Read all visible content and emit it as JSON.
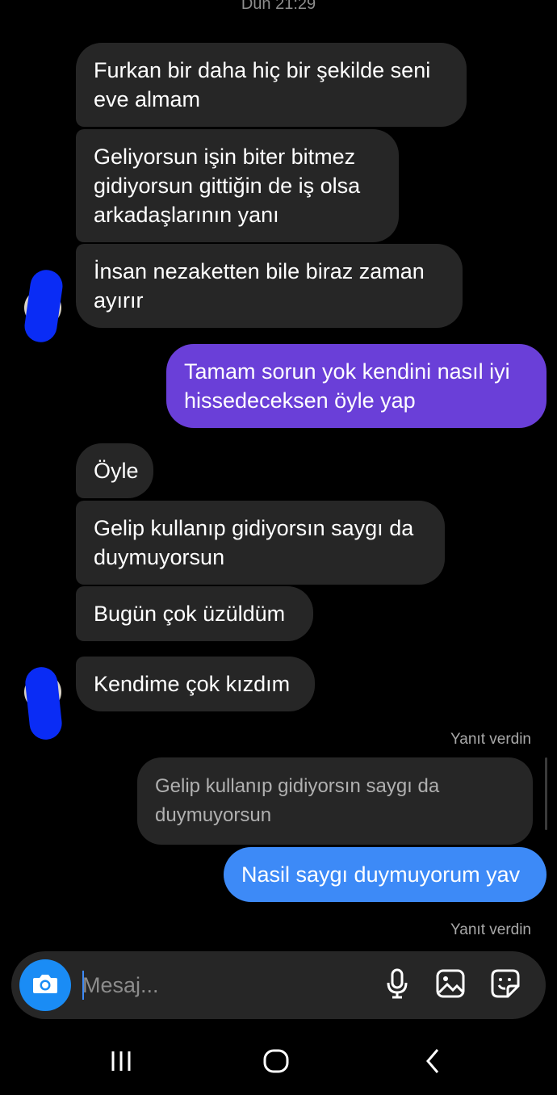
{
  "header": {
    "timestamp": "Dün 21:29"
  },
  "messages": {
    "m1": "Furkan bir daha hiç bir şekilde seni eve almam",
    "m2": "Geliyorsun işin biter bitmez gidiyorsun gittiğin de iş olsa arkadaşlarının yanı",
    "m3": "İnsan nezaketten bile biraz zaman ayırır",
    "m4": "Tamam sorun yok kendini nasıl iyi hissedeceksen öyle yap",
    "m5": "Öyle",
    "m6": "Gelip kullanıp gidiyorsın saygı da duymuyorsun",
    "m7": "Bugün çok üzüldüm",
    "m8": "Kendime çok kızdım",
    "reply1_label": "Yanıt verdin",
    "reply1_quote": "Gelip kullanıp gidiyorsın saygı da duymuyorsun",
    "m9": "Nasil saygı duymuyorum yav",
    "reply2_label": "Yanıt verdin"
  },
  "composer": {
    "placeholder": "Mesaj...",
    "icons": [
      "camera-icon",
      "microphone-icon",
      "gallery-icon",
      "sticker-icon"
    ]
  },
  "navbar": {
    "icons": [
      "recent-apps-icon",
      "home-icon",
      "back-icon"
    ]
  },
  "colors": {
    "incoming_bubble": "#262626",
    "outgoing_purple": "#6a3fd8",
    "outgoing_blue": "#3d8af7",
    "camera_button": "#1a8cf5",
    "censor_blob": "#0a2cf5"
  }
}
